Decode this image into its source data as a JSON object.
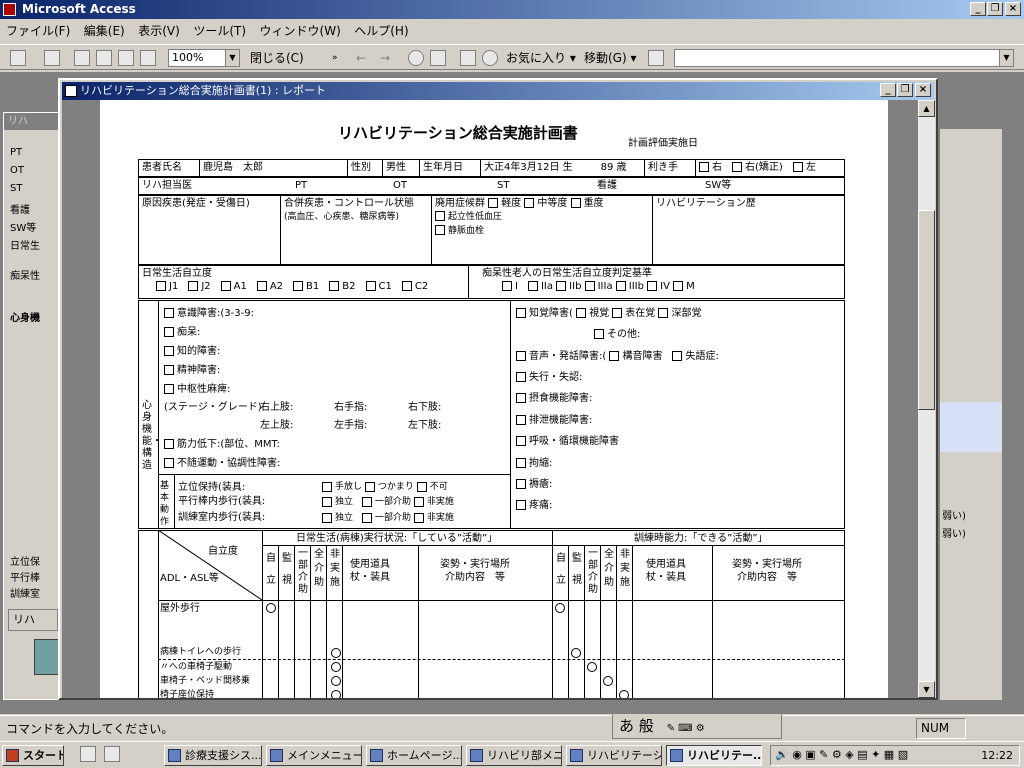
{
  "app": {
    "title": "Microsoft Access"
  },
  "menu": [
    "ファイル(F)",
    "編集(E)",
    "表示(V)",
    "ツール(T)",
    "ウィンドウ(W)",
    "ヘルプ(H)"
  ],
  "toolbar": {
    "zoom": "100%",
    "close_label": "閉じる(C)",
    "favorites": "お気に入り",
    "move": "移動(G)",
    "address": ""
  },
  "report_window": {
    "title": "リハビリテーション総合実施計画書(1) : レポート"
  },
  "report": {
    "title": "リハビリテーション総合実施計画書",
    "eval_date_label": "計画評価実施日",
    "patient_label": "患者氏名",
    "patient_name": "鹿児島　太郎",
    "sex_label": "性別",
    "sex": "男性",
    "dob_label": "生年月日",
    "dob": "大正4年3月12日 生",
    "age": "89 歳",
    "hand_label": "利き手",
    "hand_right": "右",
    "hand_right_corrected": "右(矯正)",
    "hand_left": "左",
    "doctor_label": "リハ担当医",
    "pt_label": "PT",
    "ot_label": "OT",
    "st_label": "ST",
    "nurse_label": "看護",
    "sw_label": "SW等",
    "cause_label": "原因疾患(発症・受傷日)",
    "comorb_label": "合併疾患・コントロール状態",
    "comorb_note": "(高血圧、心疾患、糖尿病等)",
    "disuse_label": "廃用症候群",
    "disuse_options": [
      "軽度",
      "中等度",
      "重度"
    ],
    "disuse_items": [
      "起立性低血圧",
      "静脈血栓"
    ],
    "history_label": "リハビリテーション歴",
    "adl_level_label": "日常生活自立度",
    "adl_levels": [
      "J1",
      "J2",
      "A1",
      "A2",
      "B1",
      "B2",
      "C1",
      "C2"
    ],
    "dementia_label": "痴呆性老人の日常生活自立度判定基準",
    "dementia_levels": [
      "I",
      "IIa",
      "IIb",
      "IIIa",
      "IIIb",
      "IV",
      "M"
    ],
    "mind_label": "心身機能・構造",
    "left_items": [
      "意識障害:(3-3-9:",
      "痴呆:",
      "知的障害:",
      "精神障害:",
      "中枢性麻痺:"
    ],
    "stage_label": "(ステージ・グレード)",
    "limbs": [
      "右上肢:",
      "右手指:",
      "右下肢:",
      "左上肢:",
      "左手指:",
      "左下肢:"
    ],
    "left_items2": [
      "筋力低下:(部位、MMT:",
      "不随運動・協調性障害:"
    ],
    "right_items": [
      "知覚障害(",
      "視覚",
      "表在覚",
      "深部覚",
      "その他:",
      "音声・発話障害:(",
      "構音障害",
      "失語症:",
      "失行・失認:",
      "摂食機能障害:",
      "排泄機能障害:",
      "呼吸・循環機能障害",
      "拘縮:",
      "褥瘡:",
      "疼痛:"
    ],
    "basic_label": "基本動作",
    "basic_items": [
      "立位保持(装具:",
      "平行棒内歩行(装具:",
      "訓練室内歩行(装具:"
    ],
    "basic_opts": [
      "手放し",
      "つかまり",
      "不可",
      "独立",
      "一部介助",
      "非実施",
      "独立",
      "一部介助",
      "非実施"
    ],
    "adl_table": {
      "daily_header": "日常生活(病棟)実行状況:「している”活動”」",
      "train_header": "訓練時能力:「できる”活動”」",
      "corner_top": "自立度",
      "corner_bottom": "ADL・ASL等",
      "cols": [
        "自立",
        "監視",
        "一部介助",
        "全介助",
        "非実施"
      ],
      "equip": "使用道具\n杖・装具",
      "place": "姿勢・実行場所\n介助内容　等",
      "rows": [
        "屋外歩行",
        "病棟トイレへの歩行",
        "〃への車椅子駆動",
        "車椅子・ベッド間移乗",
        "椅子座位保持"
      ]
    }
  },
  "status": {
    "text": "コマンドを入力してください。",
    "num": "NUM"
  },
  "ime": {
    "mode": "あ",
    "label": "般"
  },
  "taskbar": {
    "start": "スタート",
    "tasks": [
      "診療支援シス...",
      "メインメニュー...",
      "ホームページ...",
      "リハビリ部メニ...",
      "リハビリテーショ...",
      "リハビリテー..."
    ],
    "clock": "12:22"
  }
}
